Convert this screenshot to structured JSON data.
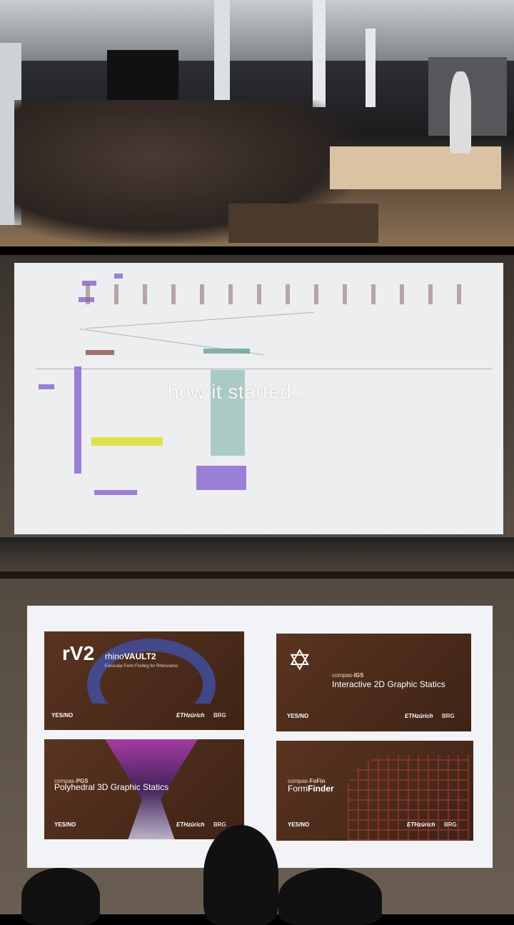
{
  "panels": {
    "audience_photo": {
      "description_icon": "photo"
    },
    "projection_1": {
      "caption": "how it started..."
    },
    "projection_2": {
      "cards": [
        {
          "logo": "rV2",
          "prefix": "rhino",
          "name": "VAULT2",
          "subtitle": "Funicular Form Finding for Rhinoceros",
          "choice": "YES/NO",
          "eth": "ETHzürich",
          "brg": "BRG"
        },
        {
          "prefix": "compas-",
          "code": "IGS",
          "title": "Interactive 2D Graphic Statics",
          "choice": "YES/NO",
          "eth": "ETHzürich",
          "brg": "BRG"
        },
        {
          "prefix": "compas-",
          "code": "PGS",
          "title": "Polyhedral 3D Graphic Statics",
          "choice": "YES/NO",
          "eth": "ETHzürich",
          "brg": "BRG"
        },
        {
          "prefix": "compas-",
          "code": "FoFin",
          "title_light": "Form",
          "title_bold": "Finder",
          "choice": "YES/NO",
          "eth": "ETHzürich",
          "brg": "BRG"
        }
      ]
    }
  }
}
